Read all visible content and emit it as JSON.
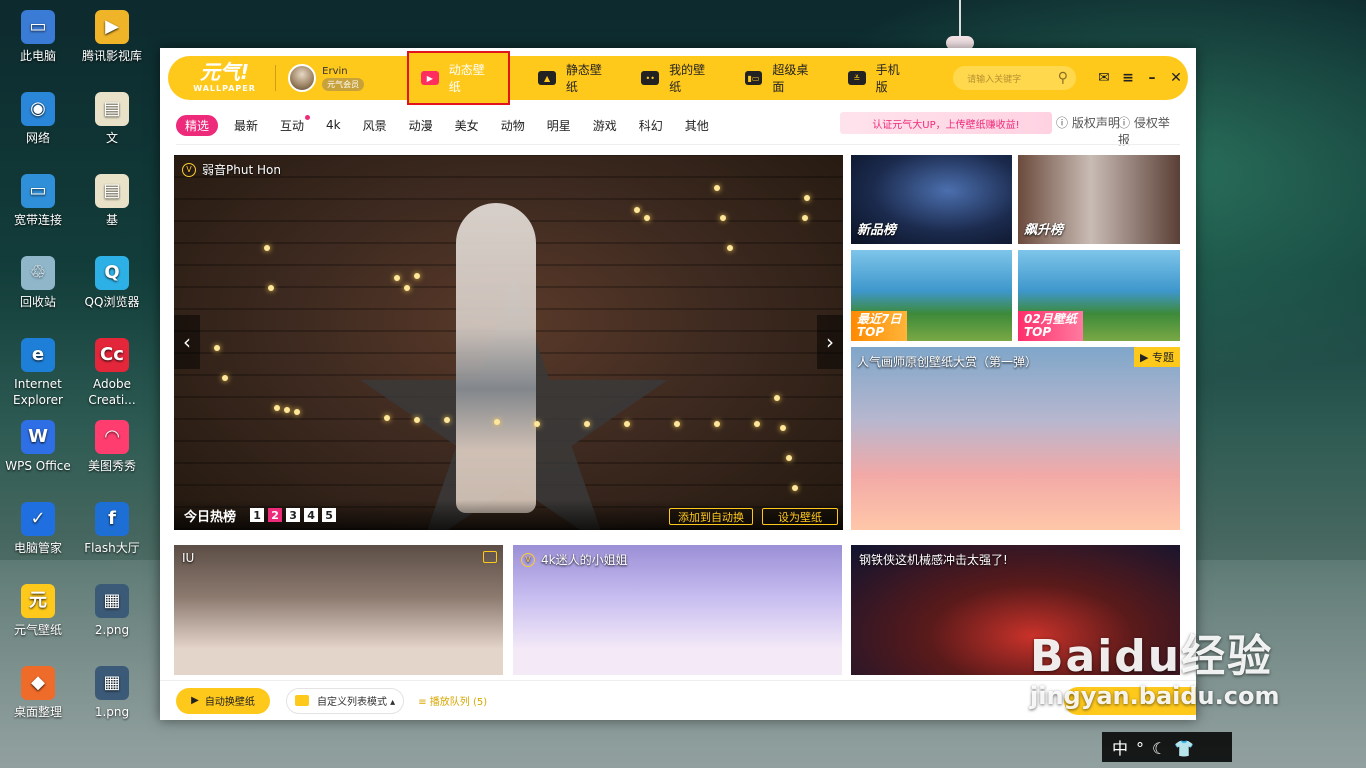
{
  "desktop": {
    "icons": [
      {
        "label": "此电脑",
        "color": "#3a7bd5",
        "glyph": "▭"
      },
      {
        "label": "腾讯影视库",
        "color": "#f0b429",
        "glyph": "▶"
      },
      {
        "label": "网络",
        "color": "#2a86d8",
        "glyph": "◉"
      },
      {
        "label": "文",
        "color": "#e9e2c8",
        "glyph": "▤"
      },
      {
        "label": "宽带连接",
        "color": "#2f8fd8",
        "glyph": "▭"
      },
      {
        "label": "基",
        "color": "#e9e2c8",
        "glyph": "▤"
      },
      {
        "label": "回收站",
        "color": "#8fb6c9",
        "glyph": "♲"
      },
      {
        "label": "QQ浏览器",
        "color": "#2db0e6",
        "glyph": "Q"
      },
      {
        "label": "Internet Explorer",
        "color": "#1e7fd8",
        "glyph": "e"
      },
      {
        "label": "Adobe Creati...",
        "color": "#e3263a",
        "glyph": "Cc"
      },
      {
        "label": "WPS Office",
        "color": "#2f6fe5",
        "glyph": "W"
      },
      {
        "label": "美图秀秀",
        "color": "#ff3d6e",
        "glyph": "◠"
      },
      {
        "label": "电脑管家",
        "color": "#1f6fe0",
        "glyph": "✓"
      },
      {
        "label": "Flash大厅",
        "color": "#1d6fd6",
        "glyph": "f"
      },
      {
        "label": "元气壁纸",
        "color": "#ffc91c",
        "glyph": "元"
      },
      {
        "label": "2.png",
        "color": "#3b5a78",
        "glyph": "▦"
      },
      {
        "label": "桌面整理",
        "color": "#ef6b2a",
        "glyph": "◆"
      },
      {
        "label": "1.png",
        "color": "#3b5a78",
        "glyph": "▦"
      }
    ]
  },
  "app": {
    "logo": {
      "text": "元气!",
      "sub": "WALLPAPER"
    },
    "user": {
      "name": "Ervin",
      "badge": "元气会员"
    },
    "nav": [
      {
        "label": "动态壁纸",
        "active": true
      },
      {
        "label": "静态壁纸",
        "active": false
      },
      {
        "label": "我的壁纸",
        "active": false
      },
      {
        "label": "超级桌面",
        "active": false
      },
      {
        "label": "手机版",
        "active": false
      }
    ],
    "search_placeholder": "请输入关键字",
    "categories": [
      "精选",
      "最新",
      "互动",
      "4k",
      "风景",
      "动漫",
      "美女",
      "动物",
      "明星",
      "游戏",
      "科幻",
      "其他"
    ],
    "promo": "认证元气大UP，上传壁纸赚收益!",
    "links": {
      "copyright": "版权声明",
      "report": "侵权举报"
    },
    "hero": {
      "title": "弱音Phut Hon",
      "hot_label": "今日热榜",
      "pages": [
        "1",
        "2",
        "3",
        "4",
        "5"
      ],
      "active_page": 2,
      "add_auto": "添加到自动换",
      "set_wallpaper": "设为壁纸"
    },
    "tiles": {
      "new": "新品榜",
      "rise": "飙升榜",
      "recent_top": "最近7日",
      "recent_top2": "TOP",
      "month_top": "02月壁纸",
      "month_top2": "TOP",
      "special_title": "人气画师原创壁纸大赏（第一弹）",
      "special_tag": "专题"
    },
    "cards": [
      {
        "title": "IU"
      },
      {
        "title": "4k迷人的小姐姐"
      },
      {
        "title": "钢铁侠这机械感冲击太强了!"
      }
    ],
    "bottom": {
      "auto_btn": "自动换壁纸",
      "list_mode": "自定义列表模式 ▴",
      "queue": "≡ 播放队列 (5)"
    }
  },
  "overlay": {
    "watermark_line1": "Baidu经验",
    "watermark_line2": "jingyan.baidu.com",
    "ime": "中°☾👕"
  }
}
